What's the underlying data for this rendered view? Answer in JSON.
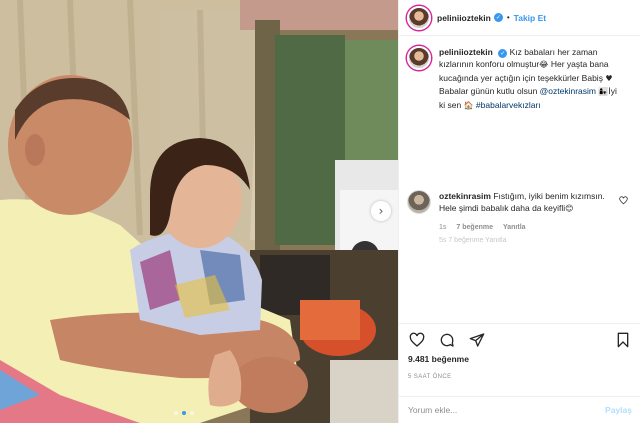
{
  "post": {
    "username": "peliniioztekin",
    "follow_label": "Takip Et",
    "separator": "•",
    "verified_glyph": "✓"
  },
  "caption": {
    "username": "peliniioztekin",
    "text_part1": "Kız babaları her zaman kızlarının konforu olmuştur",
    "emoji1": "😂",
    "text_part2": " Her yaşta bana kucağında yer açtığın için teşekkürler Babiş ",
    "heart": "♥",
    "text_part3": " Babalar günün kutlu olsun ",
    "mention": "@oztekinrasim",
    "emoji2": "👩‍👧",
    "text_part4": "İyi ki sen ",
    "emoji3": "🏠",
    "hashtag": "#babalarvekızları"
  },
  "faded_meta": "5s  7 beğenme  Yanıtla",
  "comment": {
    "username": "oztekinrasim",
    "text": " Fıstığım, iyiki benim kızımsın. Hele şimdi babalık daha da keyifli",
    "emoji": "😊",
    "age": "1s",
    "likes": "7 beğenme",
    "reply": "Yanıtla"
  },
  "likes_count": "9.481 beğenme",
  "timestamp": "5 SAAT ÖNCE",
  "add_comment": {
    "placeholder": "Yorum ekle...",
    "post_label": "Paylaş"
  },
  "carousel": {
    "next_glyph": "›",
    "pages": 3,
    "active": 1
  },
  "colors": {
    "accent": "#3897f0",
    "mention": "#00376b",
    "muted": "#8e8e8e",
    "post_disabled": "#b2dffc"
  },
  "icons": {
    "like": "heart-icon",
    "comment": "comment-icon",
    "share": "share-icon",
    "save": "bookmark-icon"
  }
}
